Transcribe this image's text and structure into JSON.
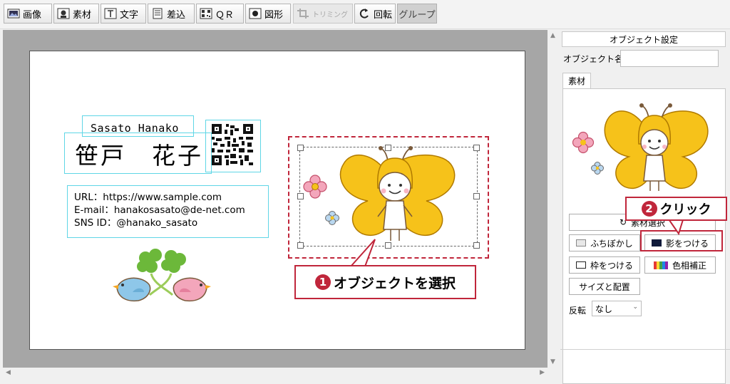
{
  "toolbar": {
    "buttons": [
      {
        "label": "画像",
        "icon": "image-icon"
      },
      {
        "label": "素材",
        "icon": "material-icon"
      },
      {
        "label": "文字",
        "icon": "text-icon"
      },
      {
        "label": "差込",
        "icon": "insert-icon"
      },
      {
        "label": "ＱＲ",
        "icon": "qr-icon"
      },
      {
        "label": "図形",
        "icon": "shape-icon"
      },
      {
        "label": "トリミング",
        "icon": "trim-icon"
      },
      {
        "label": "回転",
        "icon": "rotate-icon"
      },
      {
        "label": "グループ"
      }
    ]
  },
  "card": {
    "name_romaji": "Sasato Hanako",
    "name_kanji": "笹戸　花子",
    "url": "URL：https://www.sample.com",
    "email": "E-mail：hanakosasato@de-net.com",
    "sns": "SNS ID：@hanako_sasato"
  },
  "callouts": {
    "step1": {
      "num": "1",
      "text": "オブジェクトを選択"
    },
    "step2": {
      "num": "2",
      "text": "クリック"
    }
  },
  "panel": {
    "header": "オブジェクト設定",
    "object_name_label": "オブジェクト名",
    "object_name_value": "",
    "tab_label": "素材",
    "select_material": "素材選択",
    "border_blur": "ふちぼかし",
    "add_shadow": "影をつける",
    "add_frame": "枠をつける",
    "hue_correct": "色相補正",
    "size_position": "サイズと配置",
    "flip_label": "反転",
    "flip_value": "なし"
  },
  "colors": {
    "accent": "#c0263b",
    "selection": "#5fd6e6",
    "butterfly": "#f6c21a"
  }
}
